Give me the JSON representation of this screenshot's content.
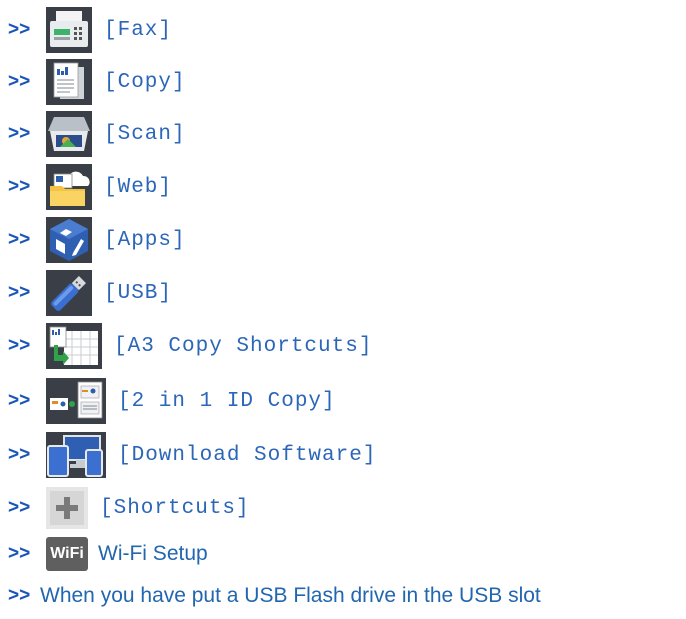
{
  "items": [
    {
      "label": "[Fax]",
      "icon": "fax-icon"
    },
    {
      "label": "[Copy]",
      "icon": "copy-icon"
    },
    {
      "label": "[Scan]",
      "icon": "scan-icon"
    },
    {
      "label": "[Web]",
      "icon": "web-icon"
    },
    {
      "label": "[Apps]",
      "icon": "apps-icon"
    },
    {
      "label": "[USB]",
      "icon": "usb-icon"
    },
    {
      "label": "[A3 Copy Shortcuts]",
      "icon": "a3-copy-shortcuts-icon"
    },
    {
      "label": "[2 in 1 ID Copy]",
      "icon": "id-copy-icon"
    },
    {
      "label": "[Download Software]",
      "icon": "download-software-icon"
    },
    {
      "label": "[Shortcuts]",
      "icon": "shortcuts-icon"
    },
    {
      "label": "Wi-Fi Setup",
      "icon": "wifi-icon",
      "badge": "WiFi"
    },
    {
      "label": "When you have put a USB Flash drive in the USB slot"
    }
  ],
  "arrow": ">>",
  "colors": {
    "link": "#2266b0",
    "arrow": "#1a56b8"
  }
}
